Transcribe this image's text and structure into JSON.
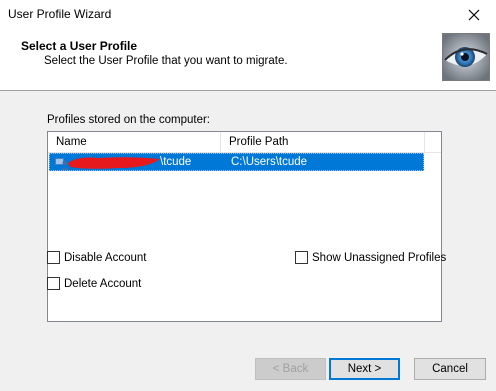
{
  "window": {
    "title": "User Profile Wizard"
  },
  "header": {
    "title": "Select a User Profile",
    "subtitle": "Select the User Profile that you want to migrate.",
    "image_icon": "eye-icon"
  },
  "profiles": {
    "label": "Profiles stored on the computer:",
    "columns": [
      "Name",
      "Profile Path"
    ],
    "rows": [
      {
        "name_visible": "\\tcude",
        "path": "C:\\Users\\tcude",
        "selected": true
      }
    ]
  },
  "options": {
    "disable_account": {
      "label": "Disable Account",
      "checked": false
    },
    "delete_account": {
      "label": "Delete Account",
      "checked": false
    },
    "show_unassigned": {
      "label": "Show Unassigned Profiles",
      "checked": false
    }
  },
  "buttons": {
    "back": "< Back",
    "next": "Next >",
    "cancel": "Cancel"
  },
  "colors": {
    "selection": "#0078d7",
    "redaction": "#e8191c"
  }
}
